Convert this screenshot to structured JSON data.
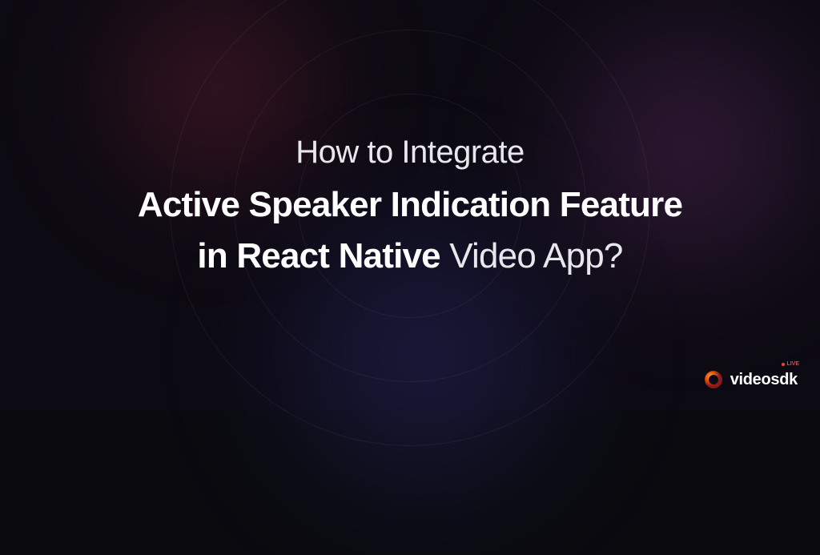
{
  "title": {
    "line1": "How to Integrate",
    "line2": "Active Speaker Indication Feature",
    "line3_bold": "in React Native",
    "line3_normal": " Video App?"
  },
  "logo": {
    "text": "videosdk",
    "badge": "LIVE"
  },
  "colors": {
    "background": "#0c0a12",
    "glow_red": "#6b2035",
    "glow_purple": "#5a2a5e",
    "glow_blue": "#2a2a6b",
    "text_primary": "#ffffff",
    "text_secondary": "#e8e8ec",
    "accent_red": "#ff3b3b"
  }
}
